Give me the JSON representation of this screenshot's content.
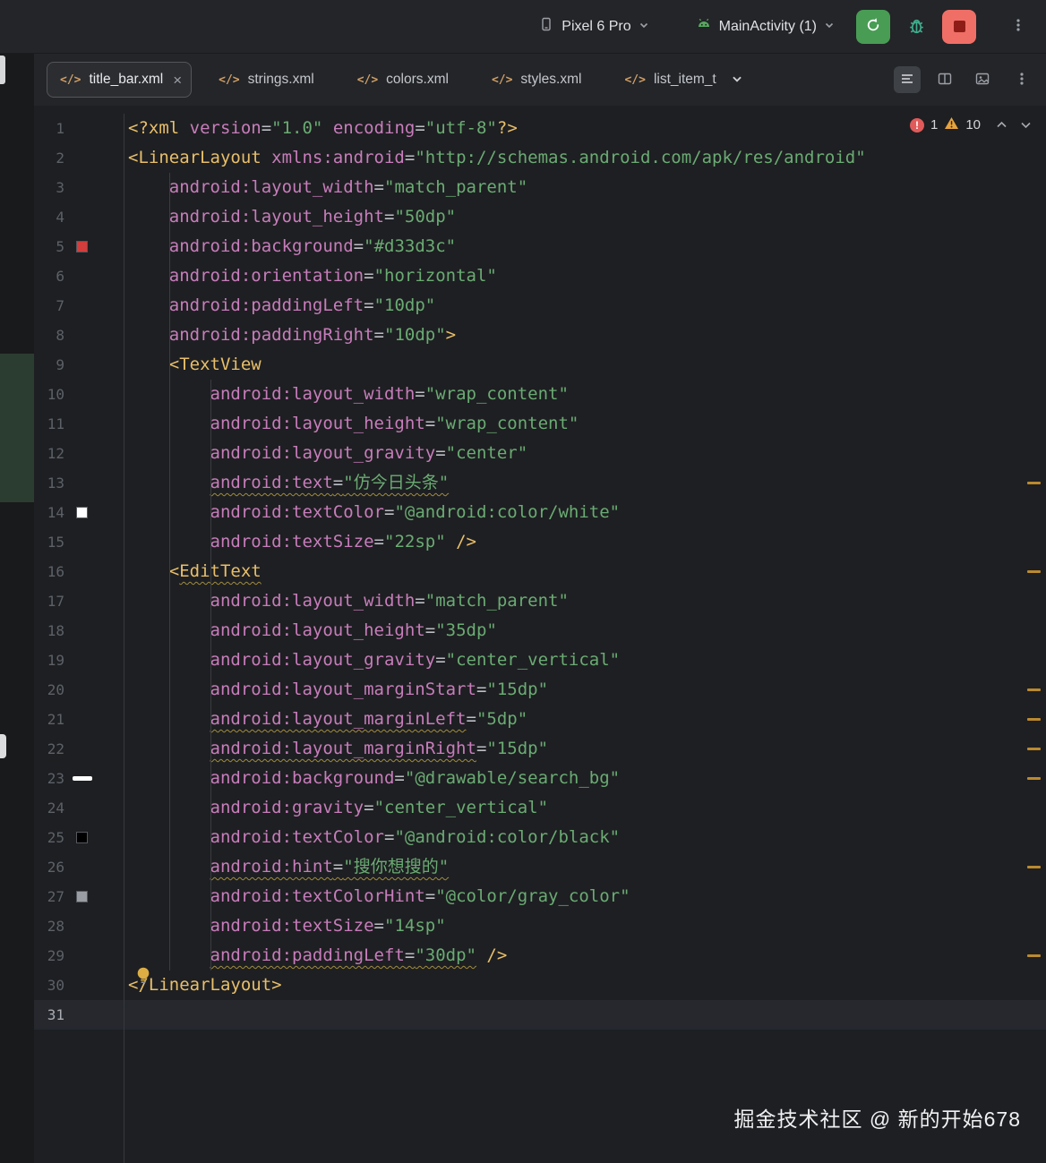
{
  "toolbar": {
    "device_label": "Pixel 6 Pro",
    "run_config_label": "MainActivity (1)"
  },
  "tabs": {
    "file_icon": "</>",
    "close_glyph": "×",
    "items": [
      {
        "label": "title_bar.xml",
        "active": true,
        "closable": true
      },
      {
        "label": "strings.xml",
        "active": false,
        "closable": false
      },
      {
        "label": "colors.xml",
        "active": false,
        "closable": false
      },
      {
        "label": "styles.xml",
        "active": false,
        "closable": false
      },
      {
        "label": "list_item_t",
        "active": false,
        "closable": false
      }
    ]
  },
  "inspections": {
    "error_count": "1",
    "warning_count": "10"
  },
  "editor": {
    "warning_lines": [
      13,
      16,
      20,
      21,
      22,
      23,
      26,
      29
    ],
    "lines": [
      {
        "n": 1,
        "tok": [
          [
            "t",
            "<?xml "
          ],
          [
            "a",
            "version"
          ],
          [
            "p",
            "="
          ],
          [
            "s",
            "\"1.0\""
          ],
          [
            "p",
            " "
          ],
          [
            "a",
            "encoding"
          ],
          [
            "p",
            "="
          ],
          [
            "s",
            "\"utf-8\""
          ],
          [
            "t",
            "?>"
          ]
        ]
      },
      {
        "n": 2,
        "tok": [
          [
            "t",
            "<LinearLayout "
          ],
          [
            "a",
            "xmlns:android"
          ],
          [
            "p",
            "="
          ],
          [
            "s",
            "\"http://schemas.android.com/apk/res/android\""
          ]
        ]
      },
      {
        "n": 3,
        "tok": [
          [
            "p",
            "    "
          ],
          [
            "a",
            "android:layout_width"
          ],
          [
            "p",
            "="
          ],
          [
            "s",
            "\"match_parent\""
          ]
        ]
      },
      {
        "n": 4,
        "tok": [
          [
            "p",
            "    "
          ],
          [
            "a",
            "android:layout_height"
          ],
          [
            "p",
            "="
          ],
          [
            "s",
            "\"50dp\""
          ]
        ]
      },
      {
        "n": 5,
        "mark": {
          "type": "square",
          "color": "#d33d3c"
        },
        "tok": [
          [
            "p",
            "    "
          ],
          [
            "a",
            "android:background"
          ],
          [
            "p",
            "="
          ],
          [
            "s",
            "\"#d33d3c\""
          ]
        ]
      },
      {
        "n": 6,
        "tok": [
          [
            "p",
            "    "
          ],
          [
            "a",
            "android:orientation"
          ],
          [
            "p",
            "="
          ],
          [
            "s",
            "\"horizontal\""
          ]
        ]
      },
      {
        "n": 7,
        "tok": [
          [
            "p",
            "    "
          ],
          [
            "a",
            "android:paddingLeft"
          ],
          [
            "p",
            "="
          ],
          [
            "s",
            "\"10dp\""
          ]
        ]
      },
      {
        "n": 8,
        "tok": [
          [
            "p",
            "    "
          ],
          [
            "a",
            "android:paddingRight"
          ],
          [
            "p",
            "="
          ],
          [
            "s",
            "\"10dp\""
          ],
          [
            "t",
            ">"
          ]
        ]
      },
      {
        "n": 9,
        "tok": [
          [
            "p",
            "    "
          ],
          [
            "t",
            "<TextView"
          ]
        ]
      },
      {
        "n": 10,
        "tok": [
          [
            "p",
            "        "
          ],
          [
            "a",
            "android:layout_width"
          ],
          [
            "p",
            "="
          ],
          [
            "s",
            "\"wrap_content\""
          ]
        ]
      },
      {
        "n": 11,
        "tok": [
          [
            "p",
            "        "
          ],
          [
            "a",
            "android:layout_height"
          ],
          [
            "p",
            "="
          ],
          [
            "s",
            "\"wrap_content\""
          ]
        ]
      },
      {
        "n": 12,
        "tok": [
          [
            "p",
            "        "
          ],
          [
            "a",
            "android:layout_gravity"
          ],
          [
            "p",
            "="
          ],
          [
            "s",
            "\"center\""
          ]
        ]
      },
      {
        "n": 13,
        "tok": [
          [
            "p",
            "        "
          ],
          [
            "a",
            "android:text",
            1
          ],
          [
            "p",
            "=",
            1
          ],
          [
            "s",
            "\"仿今日头条\"",
            1
          ]
        ]
      },
      {
        "n": 14,
        "mark": {
          "type": "square",
          "color": "#ffffff"
        },
        "tok": [
          [
            "p",
            "        "
          ],
          [
            "a",
            "android:textColor"
          ],
          [
            "p",
            "="
          ],
          [
            "s",
            "\"@android:color/white\""
          ]
        ]
      },
      {
        "n": 15,
        "tok": [
          [
            "p",
            "        "
          ],
          [
            "a",
            "android:textSize"
          ],
          [
            "p",
            "="
          ],
          [
            "s",
            "\"22sp\""
          ],
          [
            "p",
            " "
          ],
          [
            "t",
            "/>"
          ]
        ]
      },
      {
        "n": 16,
        "tok": [
          [
            "p",
            "    "
          ],
          [
            "t",
            "<"
          ],
          [
            "t",
            "EditText",
            1
          ]
        ]
      },
      {
        "n": 17,
        "tok": [
          [
            "p",
            "        "
          ],
          [
            "a",
            "android:layout_width"
          ],
          [
            "p",
            "="
          ],
          [
            "s",
            "\"match_parent\""
          ]
        ]
      },
      {
        "n": 18,
        "tok": [
          [
            "p",
            "        "
          ],
          [
            "a",
            "android:layout_height"
          ],
          [
            "p",
            "="
          ],
          [
            "s",
            "\"35dp\""
          ]
        ]
      },
      {
        "n": 19,
        "tok": [
          [
            "p",
            "        "
          ],
          [
            "a",
            "android:layout_gravity"
          ],
          [
            "p",
            "="
          ],
          [
            "s",
            "\"center_vertical\""
          ]
        ]
      },
      {
        "n": 20,
        "tok": [
          [
            "p",
            "        "
          ],
          [
            "a",
            "android:layout_marginStart"
          ],
          [
            "p",
            "="
          ],
          [
            "s",
            "\"15dp\""
          ]
        ]
      },
      {
        "n": 21,
        "tok": [
          [
            "p",
            "        "
          ],
          [
            "a",
            "android:layout_marginLeft",
            1
          ],
          [
            "p",
            "="
          ],
          [
            "s",
            "\"5dp\""
          ]
        ]
      },
      {
        "n": 22,
        "tok": [
          [
            "p",
            "        "
          ],
          [
            "a",
            "android:layout_marginRight",
            1
          ],
          [
            "p",
            "="
          ],
          [
            "s",
            "\"15dp\""
          ]
        ]
      },
      {
        "n": 23,
        "mark": {
          "type": "bar",
          "color": "#ffffff"
        },
        "tok": [
          [
            "p",
            "        "
          ],
          [
            "a",
            "android:background"
          ],
          [
            "p",
            "="
          ],
          [
            "s",
            "\"@drawable/search_bg\""
          ]
        ]
      },
      {
        "n": 24,
        "tok": [
          [
            "p",
            "        "
          ],
          [
            "a",
            "android:gravity"
          ],
          [
            "p",
            "="
          ],
          [
            "s",
            "\"center_vertical\""
          ]
        ]
      },
      {
        "n": 25,
        "mark": {
          "type": "square",
          "color": "#000000"
        },
        "tok": [
          [
            "p",
            "        "
          ],
          [
            "a",
            "android:textColor"
          ],
          [
            "p",
            "="
          ],
          [
            "s",
            "\"@android:color/black\""
          ]
        ]
      },
      {
        "n": 26,
        "tok": [
          [
            "p",
            "        "
          ],
          [
            "a",
            "android:hint",
            1
          ],
          [
            "p",
            "=",
            1
          ],
          [
            "s",
            "\"搜你想搜的\"",
            1
          ]
        ]
      },
      {
        "n": 27,
        "mark": {
          "type": "square",
          "color": "#9a9da3"
        },
        "tok": [
          [
            "p",
            "        "
          ],
          [
            "a",
            "android:textColorHint"
          ],
          [
            "p",
            "="
          ],
          [
            "s",
            "\"@color/gray_color\""
          ]
        ]
      },
      {
        "n": 28,
        "tok": [
          [
            "p",
            "        "
          ],
          [
            "a",
            "android:textSize"
          ],
          [
            "p",
            "="
          ],
          [
            "s",
            "\"14sp\""
          ]
        ]
      },
      {
        "n": 29,
        "tok": [
          [
            "p",
            "        "
          ],
          [
            "a",
            "android:paddingLeft",
            1
          ],
          [
            "p",
            "=",
            1
          ],
          [
            "s",
            "\"30dp\"",
            1
          ],
          [
            "p",
            " "
          ],
          [
            "t",
            "/>"
          ]
        ]
      },
      {
        "n": 30,
        "tok": [
          [
            "t",
            "</LinearLayout>"
          ]
        ]
      },
      {
        "n": 31,
        "caret": true,
        "tok": []
      }
    ]
  },
  "watermark": {
    "text": "掘金技术社区 @ 新的开始678"
  },
  "theme": {
    "editor_bg": "#1e1f22",
    "run_green": "#499c54",
    "stop_red": "#ef6f66",
    "error_red": "#e15a5a",
    "warning_yellow": "#e8a33d",
    "tag_color": "#e8bf6a",
    "attr_color": "#c77dbb",
    "string_color": "#6aab73"
  }
}
